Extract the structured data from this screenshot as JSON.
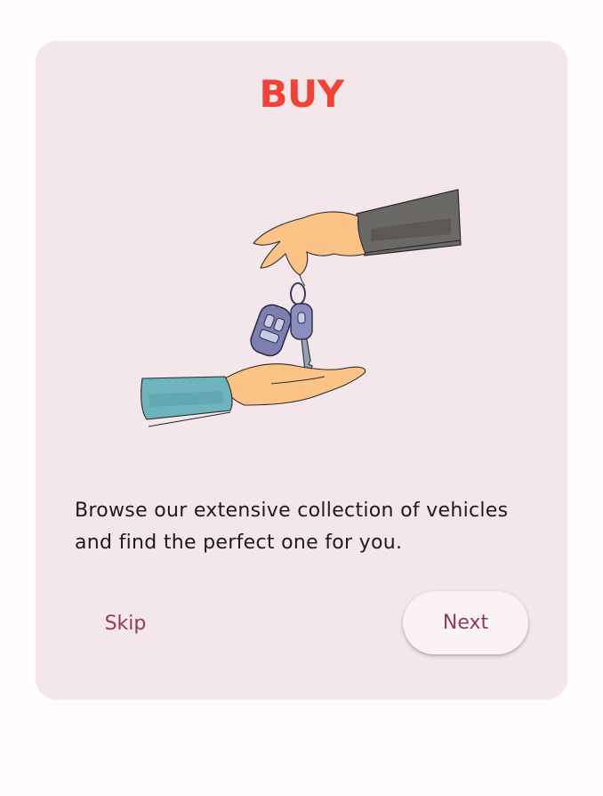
{
  "onboarding": {
    "title": "BUY",
    "description": "Browse our extensive collection of vehicles and find the perfect one for you.",
    "skip_label": "Skip",
    "next_label": "Next",
    "illustration_icon": "hand-passing-car-keys-icon"
  },
  "colors": {
    "title": "#f04336",
    "action_text": "#8e3b5e",
    "card_background": "#f3e7ec",
    "page_background": "#fffbfe"
  }
}
